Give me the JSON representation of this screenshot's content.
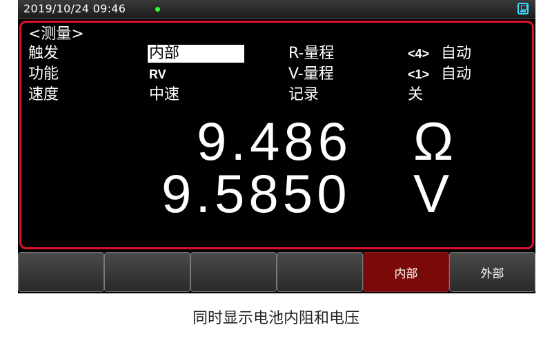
{
  "status_bar": {
    "datetime": "2019/10/24  09:46",
    "indicator_color": "#2cff3a",
    "save_icon": "save-icon"
  },
  "menu": {
    "header": "<测量>",
    "rows": [
      {
        "label": "触发",
        "value": "内部",
        "param": "R-量程",
        "param_value": "<4>",
        "param_mode": "自动"
      },
      {
        "label": "功能",
        "value": "RV",
        "param": "V-量程",
        "param_value": "<1>",
        "param_mode": "自动"
      },
      {
        "label": "速度",
        "value": "中速",
        "param": "记录",
        "param_value": "关"
      }
    ]
  },
  "readings": {
    "resistance": {
      "value": "9.486",
      "unit": "Ω"
    },
    "voltage": {
      "value": "9.5850",
      "unit": "V"
    }
  },
  "softkeys": [
    "",
    "",
    "",
    "",
    "内部",
    "外部"
  ],
  "softkey_active_index": 4,
  "colors": {
    "panel_border": "#e0102a",
    "active_key": "#7a0a0a",
    "background": "#000000"
  },
  "caption": "同时显示电池内阻和电压"
}
